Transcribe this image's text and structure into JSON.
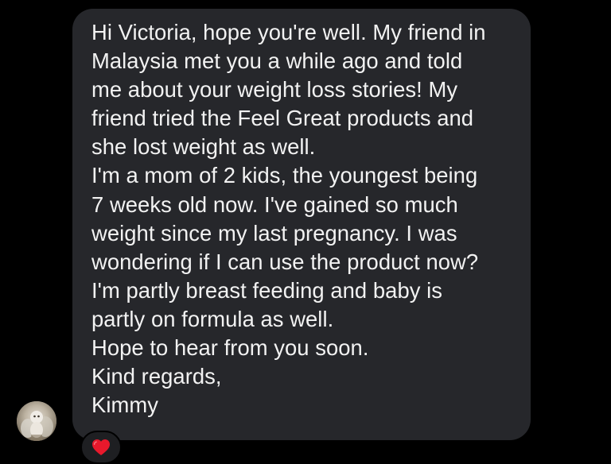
{
  "message": {
    "sender": "Kimmy",
    "lines": [
      "Hi Victoria, hope you're well. My friend in",
      "Malaysia met you a while ago and told",
      "me about your weight loss stories! My",
      "friend tried the Feel Great products and",
      "she lost weight as well.",
      "I'm a mom of 2 kids, the youngest being",
      "7 weeks old now. I've gained so much",
      "weight since my last pregnancy. I was",
      "wondering if I can use the product now?",
      "I'm partly breast feeding and baby is",
      "partly on formula as well.",
      "Hope to hear from you soon.",
      "Kind regards,",
      "Kimmy"
    ]
  },
  "avatar": {
    "icon": "profile-photo"
  },
  "reaction": {
    "icon": "red-heart-icon",
    "color": "#e8192c"
  },
  "colors": {
    "background": "#000000",
    "bubble": "#26272b",
    "text": "#f2f2f2"
  }
}
